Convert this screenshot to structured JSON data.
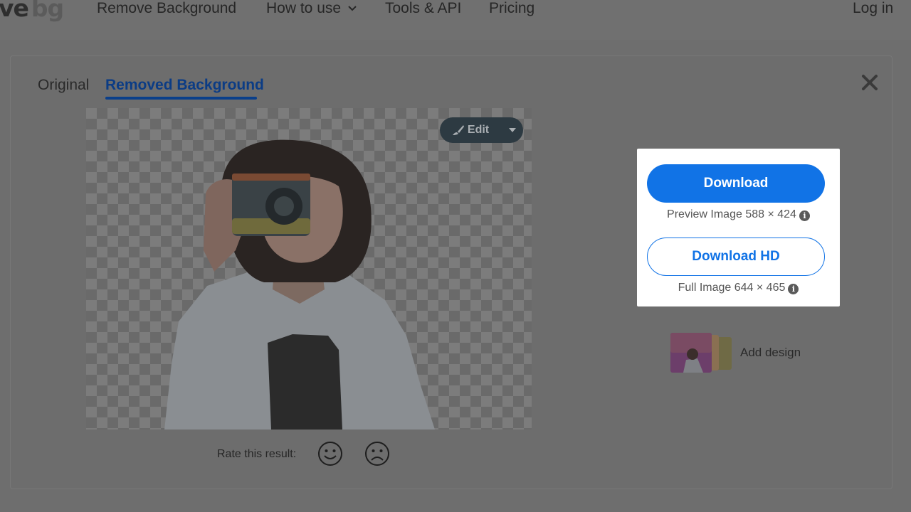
{
  "logo": {
    "part1": "ve",
    "part2": "bg"
  },
  "nav": {
    "remove_background": "Remove Background",
    "how_to_use": "How to use",
    "tools_api": "Tools & API",
    "pricing": "Pricing",
    "login": "Log in"
  },
  "tabs": {
    "original": "Original",
    "removed": "Removed Background"
  },
  "editor": {
    "edit_label": "Edit"
  },
  "rating": {
    "label": "Rate this result:"
  },
  "download": {
    "button_label": "Download",
    "preview_info": "Preview Image 588 × 424",
    "hd_button_label": "Download HD",
    "full_info": "Full Image 644 × 465"
  },
  "add_design": {
    "label": "Add design"
  },
  "colors": {
    "accent": "#1173e6",
    "tab_active": "#0b3c85",
    "overlay_bg": "#6e6e6e"
  },
  "icons": {
    "close": "close-icon",
    "edit": "brush-icon",
    "caret": "caret-down-icon",
    "happy": "smiley-icon",
    "sad": "frown-icon",
    "info": "info-icon"
  }
}
